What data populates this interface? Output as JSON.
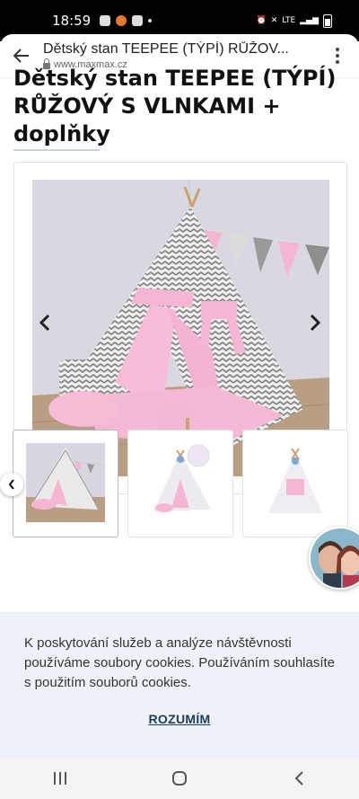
{
  "status_bar": {
    "time": "18:59",
    "network": "LTE"
  },
  "browser": {
    "page_title": "Dětský stan TEEPEE (TÝPÍ) RŮŽOV...",
    "host": "www.maxmax.cz"
  },
  "product": {
    "title_lines": [
      "Dětský stan TEEPEE (TÝPÍ)",
      "RŮŽOVÝ S VLNKAMI +",
      "doplňky"
    ]
  },
  "cookie_banner": {
    "text": "K poskytování služeb a analýze návštěvnosti používáme soubory cookies. Používáním souhlasíte s použitím souborů cookies.",
    "button": "ROZUMÍM"
  },
  "colors": {
    "accent_pink": "#f4b6d2",
    "wall": "#d7d5dc",
    "floor": "#b49c80",
    "button_text": "#1e3c5a"
  }
}
